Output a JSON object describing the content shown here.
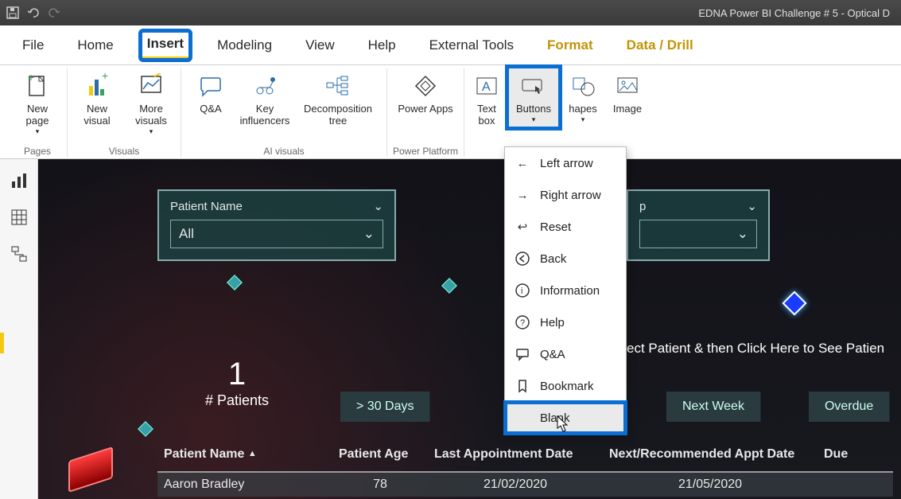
{
  "titlebar": {
    "title": "EDNA Power BI Challenge # 5 - Optical D"
  },
  "tabs": {
    "file": "File",
    "home": "Home",
    "insert": "Insert",
    "modeling": "Modeling",
    "view": "View",
    "help": "Help",
    "external": "External Tools",
    "format": "Format",
    "datadrill": "Data / Drill"
  },
  "ribbon": {
    "new_page": "New\npage",
    "new_visual": "New\nvisual",
    "more_visuals": "More\nvisuals",
    "qa": "Q&A",
    "key_inf": "Key\ninfluencers",
    "decomp": "Decomposition\ntree",
    "powerapps": "Power Apps",
    "textbox": "Text\nbox",
    "buttons": "Buttons",
    "shapes": "hapes",
    "image": "Image",
    "groups": {
      "pages": "Pages",
      "visuals": "Visuals",
      "ai": "AI visuals",
      "pp": "Power Platform"
    }
  },
  "menu": {
    "left": "Left arrow",
    "right": "Right arrow",
    "reset": "Reset",
    "back": "Back",
    "info": "Information",
    "help": "Help",
    "qa": "Q&A",
    "bookmark": "Bookmark",
    "blank": "Blank"
  },
  "canvas": {
    "slicer1": {
      "label": "Patient Name",
      "value": "All"
    },
    "slicer2": {
      "label_partial": "p"
    },
    "kpi": {
      "value": "1",
      "caption": "# Patients"
    },
    "chips": {
      "c1": "> 30 Days",
      "c2": "Next Week",
      "c3": "Overdue"
    },
    "banner": "ect Patient & then Click Here to See Patien",
    "table": {
      "cols": {
        "name": "Patient Name",
        "age": "Patient Age",
        "last": "Last Appointment Date",
        "next": "Next/Recommended Appt Date",
        "due": "Due"
      },
      "row": {
        "name": "Aaron Bradley",
        "age": "78",
        "last": "21/02/2020",
        "next": "21/05/2020"
      }
    }
  }
}
